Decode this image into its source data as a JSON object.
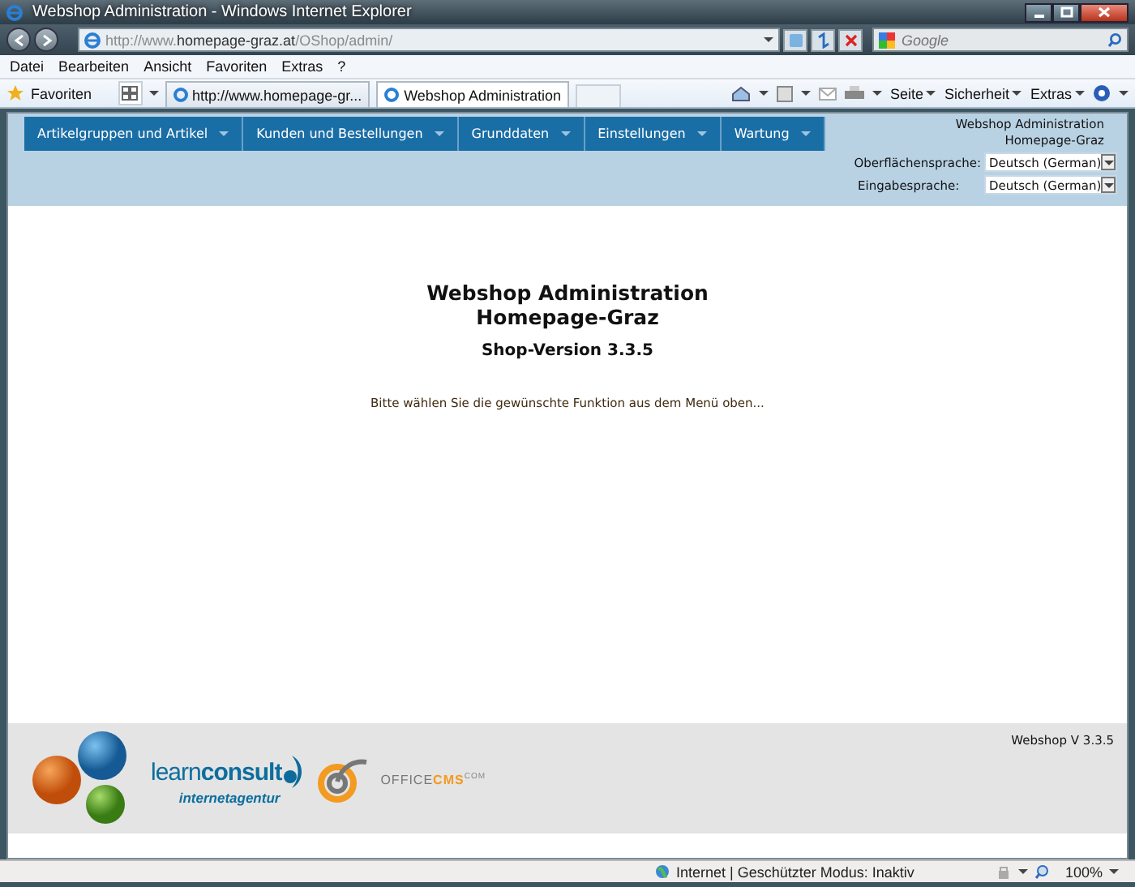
{
  "window": {
    "title": "Webshop Administration - Windows Internet Explorer"
  },
  "address_bar": {
    "url_start": "http://www.",
    "url_host": "homepage-graz.at",
    "url_path": "/OShop/admin/"
  },
  "search": {
    "placeholder": "Google"
  },
  "menu_bar": [
    "Datei",
    "Bearbeiten",
    "Ansicht",
    "Favoriten",
    "Extras",
    "?"
  ],
  "favorites": "Favoriten",
  "tabs": [
    {
      "label": "http://www.homepage-gr...",
      "selected": false
    },
    {
      "label": "Webshop Administration",
      "selected": true
    }
  ],
  "command_bar": [
    "Seite",
    "Sicherheit",
    "Extras"
  ],
  "nav": [
    "Artikelgruppen und Artikel",
    "Kunden und Bestellungen",
    "Grunddaten",
    "Einstellungen",
    "Wartung"
  ],
  "header_info": {
    "lines": [
      "Webshop Administration",
      "Homepage-Graz"
    ],
    "languages": [
      {
        "label": "Oberflächensprache:",
        "value": "Deutsch (German)"
      },
      {
        "label": "Eingabesprache:",
        "value": "Deutsch (German)"
      }
    ]
  },
  "main": {
    "title_lines": [
      "Webshop Administration",
      "Homepage-Graz"
    ],
    "version": "Shop-Version 3.3.5",
    "message": "Bitte wählen Sie die gewünschte Funktion aus dem Menü oben..."
  },
  "footer": {
    "version": "Webshop V 3.3.5",
    "learn_logo": "learn**consult**",
    "learn_tagline": "internetagentur",
    "office_logo": {
      "word": "OFFICE",
      "accent": "CMS",
      "suffix": "COM"
    }
  },
  "status_bar": {
    "zone": "Internet | Geschützter Modus: Inaktiv",
    "zoom": "100%"
  }
}
